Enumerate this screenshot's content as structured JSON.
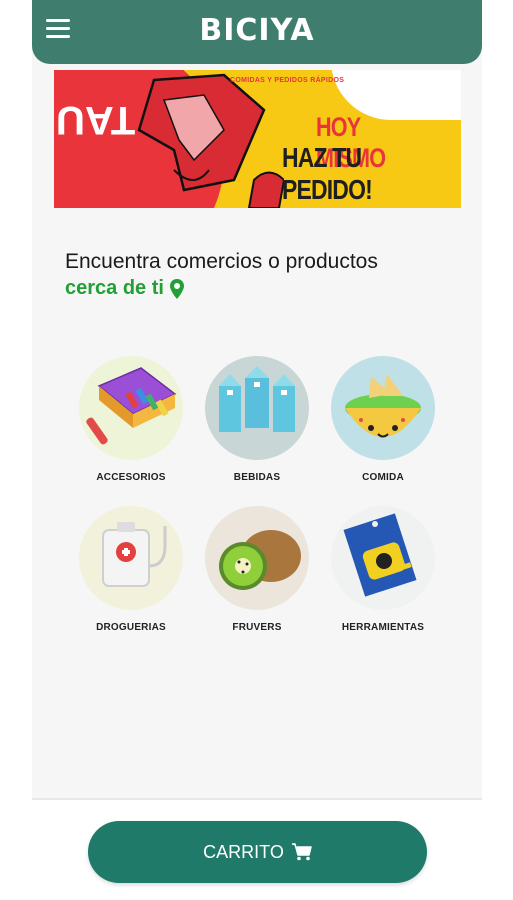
{
  "header": {
    "brand": "BICIYA",
    "menu_icon": "hamburger-icon",
    "color": "#3f7e6e"
  },
  "banner": {
    "small_text": "COMIDAS Y PEDIDOS RÁPIDOS",
    "line1": "HOY MISMO",
    "line2": "HAZ TU PEDIDO!",
    "bg_text": "VE TAU"
  },
  "intro": {
    "headline": "Encuentra comercios o productos",
    "subline": "cerca de ti",
    "pin_icon": "location-pin-icon",
    "accent": "#22a035"
  },
  "categories": [
    {
      "label": "ACCESORIOS"
    },
    {
      "label": "BEBIDAS"
    },
    {
      "label": "COMIDA"
    },
    {
      "label": "DROGUERIAS"
    },
    {
      "label": "FRUVERS"
    },
    {
      "label": "HERRAMIENTAS"
    }
  ],
  "cart": {
    "label": "CARRITO",
    "icon": "cart-icon",
    "color": "#1f7a69"
  }
}
